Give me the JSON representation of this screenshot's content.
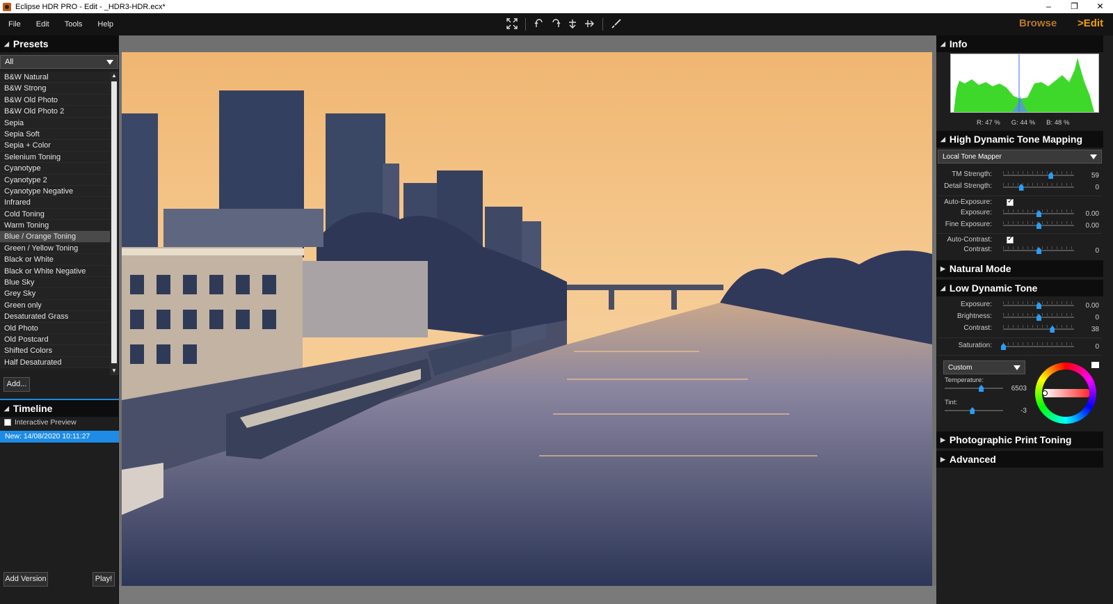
{
  "window": {
    "title": "Eclipse HDR PRO - Edit - _HDR3-HDR.ecx*",
    "min": "–",
    "restore": "❐",
    "close": "✕"
  },
  "menu": [
    "File",
    "Edit",
    "Tools",
    "Help"
  ],
  "modes": {
    "browse": "Browse",
    "edit": ">Edit"
  },
  "presets": {
    "title": "Presets",
    "filter": "All",
    "items": [
      "B&W Natural",
      "B&W Strong",
      "B&W Old Photo",
      "B&W Old Photo 2",
      "Sepia",
      "Sepia Soft",
      "Sepia + Color",
      "Selenium Toning",
      "Cyanotype",
      "Cyanotype 2",
      "Cyanotype Negative",
      "Infrared",
      "Cold Toning",
      "Warm Toning",
      "Blue / Orange Toning",
      "Green / Yellow Toning",
      "Black or White",
      "Black or White Negative",
      "Blue Sky",
      "Grey Sky",
      "Green only",
      "Desaturated Grass",
      "Old Photo",
      "Old Postcard",
      "Shifted Colors",
      "Half Desaturated"
    ],
    "selected": "Blue / Orange Toning",
    "add_label": "Add..."
  },
  "timeline": {
    "title": "Timeline",
    "interactive_preview": "Interactive Preview",
    "version": "New: 14/08/2020 10:11:27",
    "add_version": "Add Version",
    "play": "Play!"
  },
  "info": {
    "title": "Info",
    "r": "R: 47 %",
    "g": "G: 44 %",
    "b": "B: 48 %"
  },
  "hdtm": {
    "title": "High Dynamic Tone Mapping",
    "mapper": "Local Tone Mapper",
    "tm_strength": {
      "label": "TM Strength:",
      "value": "59",
      "pos": 0.67
    },
    "detail_strength": {
      "label": "Detail Strength:",
      "value": "0",
      "pos": 0.25
    },
    "auto_exposure": {
      "label": "Auto-Exposure:",
      "checked": true
    },
    "exposure": {
      "label": "Exposure:",
      "value": "0.00",
      "pos": 0.5
    },
    "fine_exposure": {
      "label": "Fine Exposure:",
      "value": "0.00",
      "pos": 0.5
    },
    "auto_contrast": {
      "label": "Auto-Contrast:",
      "checked": true
    },
    "contrast": {
      "label": "Contrast:",
      "value": "0",
      "pos": 0.5
    }
  },
  "natural_mode": {
    "title": "Natural Mode"
  },
  "ldt": {
    "title": "Low Dynamic Tone",
    "exposure": {
      "label": "Exposure:",
      "value": "0.00",
      "pos": 0.5
    },
    "brightness": {
      "label": "Brightness:",
      "value": "0",
      "pos": 0.5
    },
    "contrast": {
      "label": "Contrast:",
      "value": "38",
      "pos": 0.69
    },
    "saturation": {
      "label": "Saturation:",
      "value": "0",
      "pos": 0.0
    },
    "wb_mode": "Custom",
    "temperature": {
      "label": "Temperature:",
      "value": "6503",
      "pos": 0.62
    },
    "tint": {
      "label": "Tint:",
      "value": "-3",
      "pos": 0.47
    }
  },
  "photo_print": {
    "title": "Photographic Print Toning"
  },
  "advanced": {
    "title": "Advanced"
  },
  "icons": [
    "fit-screen-icon",
    "rotate-left-icon",
    "rotate-right-icon",
    "flip-vertical-icon",
    "flip-horizontal-icon",
    "brush-icon"
  ]
}
